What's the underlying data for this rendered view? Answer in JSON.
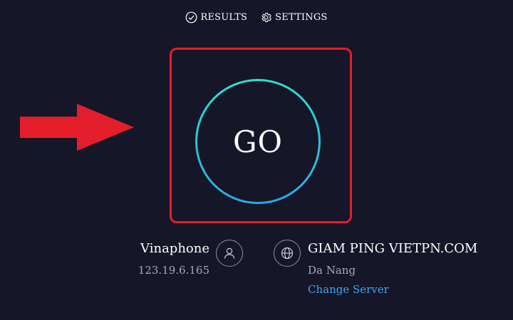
{
  "nav": {
    "results_label": "RESULTS",
    "settings_label": "SETTINGS"
  },
  "test": {
    "go_label": "GO"
  },
  "provider": {
    "name": "Vinaphone",
    "ip": "123.19.6.165"
  },
  "server": {
    "name": "GIAM PING VIETPN.COM",
    "location": "Da Nang",
    "change_label": "Change Server"
  },
  "colors": {
    "background": "#151628",
    "annotation_red": "#e31e2a",
    "ring_top": "#2ee0c8",
    "ring_bottom": "#2ba8e6",
    "link_blue": "#3aa7ef",
    "muted_text": "#a6a8b8"
  },
  "icons": {
    "results": "check-circle-icon",
    "settings": "gear-icon",
    "user": "user-icon",
    "globe": "globe-icon",
    "arrow": "arrow-right-icon"
  }
}
